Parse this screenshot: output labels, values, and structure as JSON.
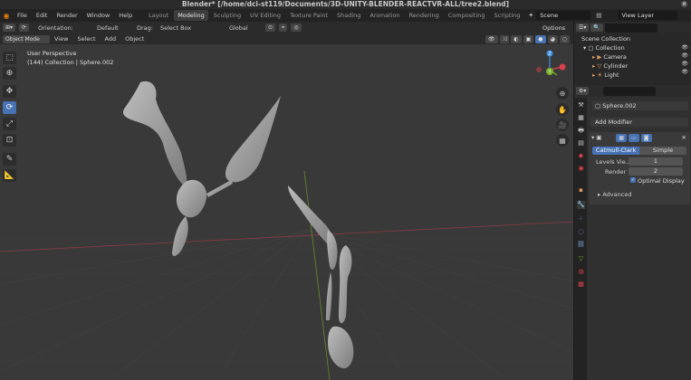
{
  "window_title": "Blender* [/home/dci-st119/Documents/3D-UNITY-BLENDER-REACTVR-ALL/tree2.blend]",
  "menus": [
    "File",
    "Edit",
    "Render",
    "Window",
    "Help"
  ],
  "workspaces": [
    {
      "label": "Layout",
      "active": false
    },
    {
      "label": "Modeling",
      "active": true
    },
    {
      "label": "Sculpting",
      "active": false
    },
    {
      "label": "UV Editing",
      "active": false
    },
    {
      "label": "Texture Paint",
      "active": false
    },
    {
      "label": "Shading",
      "active": false
    },
    {
      "label": "Animation",
      "active": false
    },
    {
      "label": "Rendering",
      "active": false
    },
    {
      "label": "Compositing",
      "active": false
    },
    {
      "label": "Scripting",
      "active": false
    }
  ],
  "scene": "Scene",
  "view_layer": "View Layer",
  "header": {
    "orientation_label": "Orientation:",
    "orientation_value": "Default",
    "drag_label": "Drag:",
    "drag_value": "Select Box",
    "transform_value": "Global",
    "options": "Options"
  },
  "header2": {
    "mode": "Object Mode",
    "view": "View",
    "select": "Select",
    "add": "Add",
    "object": "Object"
  },
  "viewport": {
    "perspective": "User Perspective",
    "object_info": "(144) Collection | Sphere.002"
  },
  "gizmo": {
    "x": "X",
    "y": "Y",
    "z": "Z"
  },
  "outliner": {
    "root": "Scene Collection",
    "collection": "Collection",
    "items": [
      "Camera",
      "Cylinder",
      "Light"
    ]
  },
  "properties": {
    "object_name": "Sphere.002",
    "add_modifier": "Add Modifier",
    "mode_catmull": "Catmull-Clark",
    "mode_simple": "Simple",
    "levels_label": "Levels Vie...",
    "levels_value": "1",
    "render_label": "Render",
    "render_value": "2",
    "optimal_display": "Optimal Display",
    "advanced": "Advanced"
  },
  "colors": {
    "accent": "#4772b3",
    "viewport": "#393939",
    "axis_x": "#d9404a",
    "axis_y": "#7ab22b",
    "axis_z": "#3a8fe0",
    "mesh": "#a3a3a3"
  }
}
